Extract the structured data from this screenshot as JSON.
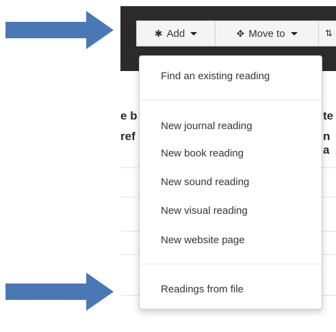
{
  "toolbar": {
    "add_label": "Add",
    "add_icon": "asterisk-icon",
    "move_label": "Move to",
    "move_icon": "move-arrows-icon",
    "extra_icon": "sort-icon"
  },
  "menu": {
    "find_existing": "Find an existing reading",
    "items": [
      "New journal reading",
      "New book reading",
      "New sound reading",
      "New visual reading",
      "New website page"
    ],
    "from_file": "Readings from file"
  },
  "background_text": {
    "row1_left": "e b",
    "row1_right": "te",
    "row2_left": "ref",
    "row2_right": "n a"
  },
  "colors": {
    "arrow": "#4a78b5",
    "topbar": "#2b2b2b",
    "button_bg": "#f4f4f4",
    "menu_text": "#333333"
  }
}
